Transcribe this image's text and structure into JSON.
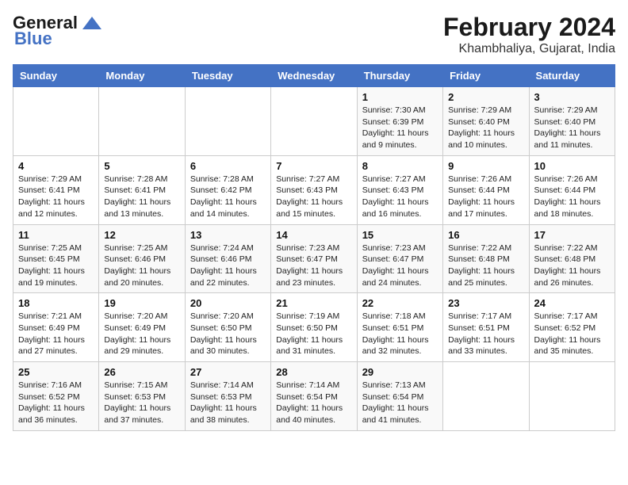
{
  "header": {
    "logo_general": "General",
    "logo_blue": "Blue",
    "month_year": "February 2024",
    "location": "Khambhaliya, Gujarat, India"
  },
  "days_of_week": [
    "Sunday",
    "Monday",
    "Tuesday",
    "Wednesday",
    "Thursday",
    "Friday",
    "Saturday"
  ],
  "weeks": [
    [
      {
        "day": "",
        "info": ""
      },
      {
        "day": "",
        "info": ""
      },
      {
        "day": "",
        "info": ""
      },
      {
        "day": "",
        "info": ""
      },
      {
        "day": "1",
        "info": "Sunrise: 7:30 AM\nSunset: 6:39 PM\nDaylight: 11 hours and 9 minutes."
      },
      {
        "day": "2",
        "info": "Sunrise: 7:29 AM\nSunset: 6:40 PM\nDaylight: 11 hours and 10 minutes."
      },
      {
        "day": "3",
        "info": "Sunrise: 7:29 AM\nSunset: 6:40 PM\nDaylight: 11 hours and 11 minutes."
      }
    ],
    [
      {
        "day": "4",
        "info": "Sunrise: 7:29 AM\nSunset: 6:41 PM\nDaylight: 11 hours and 12 minutes."
      },
      {
        "day": "5",
        "info": "Sunrise: 7:28 AM\nSunset: 6:41 PM\nDaylight: 11 hours and 13 minutes."
      },
      {
        "day": "6",
        "info": "Sunrise: 7:28 AM\nSunset: 6:42 PM\nDaylight: 11 hours and 14 minutes."
      },
      {
        "day": "7",
        "info": "Sunrise: 7:27 AM\nSunset: 6:43 PM\nDaylight: 11 hours and 15 minutes."
      },
      {
        "day": "8",
        "info": "Sunrise: 7:27 AM\nSunset: 6:43 PM\nDaylight: 11 hours and 16 minutes."
      },
      {
        "day": "9",
        "info": "Sunrise: 7:26 AM\nSunset: 6:44 PM\nDaylight: 11 hours and 17 minutes."
      },
      {
        "day": "10",
        "info": "Sunrise: 7:26 AM\nSunset: 6:44 PM\nDaylight: 11 hours and 18 minutes."
      }
    ],
    [
      {
        "day": "11",
        "info": "Sunrise: 7:25 AM\nSunset: 6:45 PM\nDaylight: 11 hours and 19 minutes."
      },
      {
        "day": "12",
        "info": "Sunrise: 7:25 AM\nSunset: 6:46 PM\nDaylight: 11 hours and 20 minutes."
      },
      {
        "day": "13",
        "info": "Sunrise: 7:24 AM\nSunset: 6:46 PM\nDaylight: 11 hours and 22 minutes."
      },
      {
        "day": "14",
        "info": "Sunrise: 7:23 AM\nSunset: 6:47 PM\nDaylight: 11 hours and 23 minutes."
      },
      {
        "day": "15",
        "info": "Sunrise: 7:23 AM\nSunset: 6:47 PM\nDaylight: 11 hours and 24 minutes."
      },
      {
        "day": "16",
        "info": "Sunrise: 7:22 AM\nSunset: 6:48 PM\nDaylight: 11 hours and 25 minutes."
      },
      {
        "day": "17",
        "info": "Sunrise: 7:22 AM\nSunset: 6:48 PM\nDaylight: 11 hours and 26 minutes."
      }
    ],
    [
      {
        "day": "18",
        "info": "Sunrise: 7:21 AM\nSunset: 6:49 PM\nDaylight: 11 hours and 27 minutes."
      },
      {
        "day": "19",
        "info": "Sunrise: 7:20 AM\nSunset: 6:49 PM\nDaylight: 11 hours and 29 minutes."
      },
      {
        "day": "20",
        "info": "Sunrise: 7:20 AM\nSunset: 6:50 PM\nDaylight: 11 hours and 30 minutes."
      },
      {
        "day": "21",
        "info": "Sunrise: 7:19 AM\nSunset: 6:50 PM\nDaylight: 11 hours and 31 minutes."
      },
      {
        "day": "22",
        "info": "Sunrise: 7:18 AM\nSunset: 6:51 PM\nDaylight: 11 hours and 32 minutes."
      },
      {
        "day": "23",
        "info": "Sunrise: 7:17 AM\nSunset: 6:51 PM\nDaylight: 11 hours and 33 minutes."
      },
      {
        "day": "24",
        "info": "Sunrise: 7:17 AM\nSunset: 6:52 PM\nDaylight: 11 hours and 35 minutes."
      }
    ],
    [
      {
        "day": "25",
        "info": "Sunrise: 7:16 AM\nSunset: 6:52 PM\nDaylight: 11 hours and 36 minutes."
      },
      {
        "day": "26",
        "info": "Sunrise: 7:15 AM\nSunset: 6:53 PM\nDaylight: 11 hours and 37 minutes."
      },
      {
        "day": "27",
        "info": "Sunrise: 7:14 AM\nSunset: 6:53 PM\nDaylight: 11 hours and 38 minutes."
      },
      {
        "day": "28",
        "info": "Sunrise: 7:14 AM\nSunset: 6:54 PM\nDaylight: 11 hours and 40 minutes."
      },
      {
        "day": "29",
        "info": "Sunrise: 7:13 AM\nSunset: 6:54 PM\nDaylight: 11 hours and 41 minutes."
      },
      {
        "day": "",
        "info": ""
      },
      {
        "day": "",
        "info": ""
      }
    ]
  ]
}
